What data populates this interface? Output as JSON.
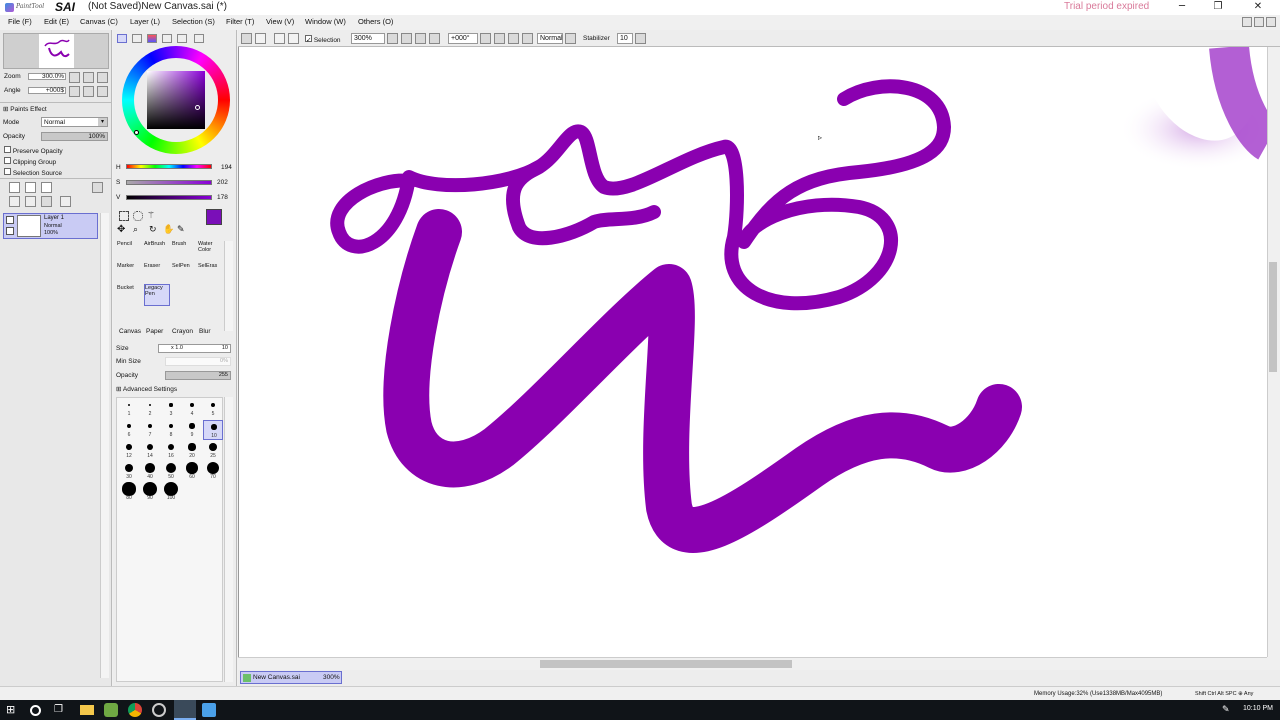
{
  "app": {
    "logo_small": "PaintTool",
    "logo_big": "SAI",
    "document_title": "(Not Saved)New Canvas.sai (*)",
    "trial_notice": "Trial period expired"
  },
  "window_controls": {
    "minimize": "─",
    "restore": "❐",
    "close": "✕"
  },
  "menu": [
    {
      "label": "File (F)"
    },
    {
      "label": "Edit (E)"
    },
    {
      "label": "Canvas (C)"
    },
    {
      "label": "Layer (L)"
    },
    {
      "label": "Selection (S)"
    },
    {
      "label": "Filter (T)"
    },
    {
      "label": "View (V)"
    },
    {
      "label": "Window (W)"
    },
    {
      "label": "Others (O)"
    }
  ],
  "navigator": {
    "zoom_label": "Zoom",
    "zoom_value": "300.0%",
    "angle_label": "Angle",
    "angle_value": "+000$"
  },
  "layer_props": {
    "paints_effect": "Paints Effect",
    "mode_label": "Mode",
    "mode_value": "Normal",
    "opacity_label": "Opacity",
    "opacity_value": "100%",
    "preserve_opacity": "Preserve Opacity",
    "clipping_group": "Clipping Group",
    "selection_source": "Selection Source"
  },
  "layers": [
    {
      "name": "Layer 1",
      "mode": "Normal",
      "opacity": "100%"
    }
  ],
  "color": {
    "current": "#7a0fb8",
    "h_label": "H",
    "h_value": "194",
    "s_label": "S",
    "s_value": "202",
    "v_label": "V",
    "v_value": "178"
  },
  "tools": [
    {
      "label": "Pencil"
    },
    {
      "label": "AirBrush"
    },
    {
      "label": "Brush"
    },
    {
      "label": "Water Color"
    },
    {
      "label": "Marker"
    },
    {
      "label": "Eraser"
    },
    {
      "label": "SelPen"
    },
    {
      "label": "SelEras"
    },
    {
      "label": "Bucket"
    },
    {
      "label": "Legacy Pen"
    }
  ],
  "tool_tabs": [
    {
      "label": "Canvas"
    },
    {
      "label": "Paper"
    },
    {
      "label": "Crayon"
    },
    {
      "label": "Blur"
    }
  ],
  "brush_settings": {
    "size_label": "Size",
    "size_mult": "x 1.0",
    "size_value": "10",
    "min_size_label": "Min Size",
    "min_size_value": "0%",
    "opacity_label": "Opacity",
    "opacity_value": "255",
    "advanced": "Advanced Settings"
  },
  "brush_sizes": [
    "1",
    "2",
    "3",
    "4",
    "5",
    "6",
    "7",
    "8",
    "9",
    "10",
    "12",
    "14",
    "16",
    "20",
    "25",
    "30",
    "40",
    "50",
    "60",
    "70",
    "80",
    "90",
    "100"
  ],
  "toolbar": {
    "selection_label": "Selection",
    "zoom_value": "300%",
    "angle_value": "+000°",
    "blend_value": "Normal",
    "stabilizer_label": "Stabilizer",
    "stabilizer_value": "10"
  },
  "canvas_tab": {
    "name": "New Canvas.sai",
    "zoom": "300%"
  },
  "status": {
    "memory": "Memory Usage:32% (Use1338MB/Max4095MB)",
    "keys": "Shift Ctrl Alt SPC ⊕ Any"
  },
  "taskbar": {
    "time": "10:10 PM"
  },
  "stroke_color": "#8a00b0"
}
